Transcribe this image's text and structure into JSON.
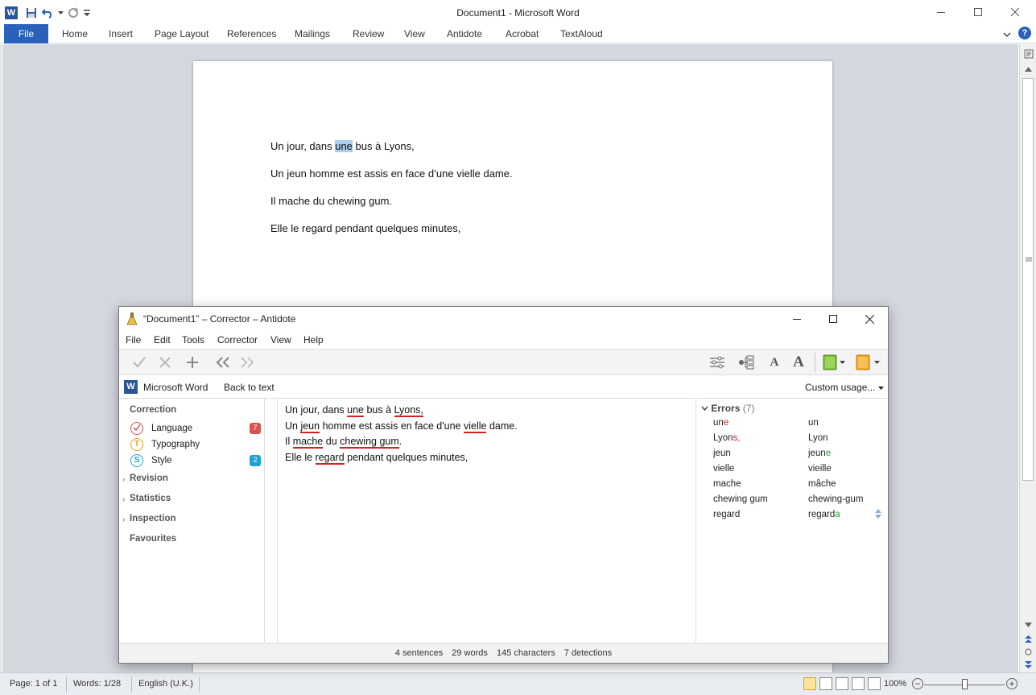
{
  "word": {
    "title": "Document1  -  Microsoft Word",
    "app_icon_letter": "W",
    "file_tab": "File",
    "tabs": [
      "Home",
      "Insert",
      "Page Layout",
      "References",
      "Mailings",
      "Review",
      "View",
      "Antidote",
      "Acrobat",
      "TextAloud"
    ],
    "help_label": "?",
    "document_lines": [
      {
        "before": "Un jour, dans ",
        "selected": "une",
        "after": " bus à Lyons,"
      },
      {
        "before": "Un jeun homme est assis en face d’une vielle dame.",
        "selected": "",
        "after": ""
      },
      {
        "before": "Il mache du chewing gum.",
        "selected": "",
        "after": ""
      },
      {
        "before": "Elle le regard pendant quelques minutes,",
        "selected": "",
        "after": ""
      }
    ],
    "status": {
      "page": "Page: 1 of 1",
      "words": "Words: 1/28",
      "language": "English (U.K.)",
      "zoom": "100%",
      "zoom_level_percent": 100
    }
  },
  "antidote": {
    "title": "“Document1” – Corrector – Antidote",
    "menu": [
      "File",
      "Edit",
      "Tools",
      "Corrector",
      "View",
      "Help"
    ],
    "source_app": "Microsoft Word",
    "back_to_text": "Back to text",
    "custom_usage": "Custom usage...",
    "nav": {
      "correction_label": "Correction",
      "items": [
        {
          "label": "Language",
          "icon_letter": "",
          "badge": "7",
          "color": "#d9534f"
        },
        {
          "label": "Typography",
          "icon_letter": "T",
          "badge": "",
          "color": "#e8a317"
        },
        {
          "label": "Style",
          "icon_letter": "S",
          "badge": "2",
          "color": "#1ea1d6"
        }
      ],
      "revision_label": "Revision",
      "statistics_label": "Statistics",
      "inspection_label": "Inspection",
      "favourites_label": "Favourites"
    },
    "text_lines": [
      [
        {
          "t": "Un jour, dans ",
          "e": false
        },
        {
          "t": "une",
          "e": true
        },
        {
          "t": " bus à ",
          "e": false
        },
        {
          "t": "Lyons,",
          "e": true
        }
      ],
      [
        {
          "t": "Un ",
          "e": false
        },
        {
          "t": "jeun",
          "e": true
        },
        {
          "t": " homme est assis en face d'une ",
          "e": false
        },
        {
          "t": "vielle",
          "e": true
        },
        {
          "t": " dame.",
          "e": false
        }
      ],
      [
        {
          "t": "Il ",
          "e": false
        },
        {
          "t": "mache",
          "e": true
        },
        {
          "t": " du ",
          "e": false
        },
        {
          "t": "chewing gum",
          "e": true
        },
        {
          "t": ".",
          "e": false
        }
      ],
      [
        {
          "t": "Elle le ",
          "e": false
        },
        {
          "t": "regard",
          "e": true
        },
        {
          "t": " pendant quelques minutes,",
          "e": false
        }
      ]
    ],
    "errors": {
      "label": "Errors",
      "count": "(7)",
      "rows": [
        {
          "word": [
            {
              "t": "un",
              "c": ""
            },
            {
              "t": "e",
              "c": "red"
            }
          ],
          "sugg": [
            {
              "t": "un",
              "c": ""
            }
          ]
        },
        {
          "word": [
            {
              "t": "Lyon",
              "c": ""
            },
            {
              "t": "s,",
              "c": "red"
            }
          ],
          "sugg": [
            {
              "t": "Lyon",
              "c": ""
            }
          ]
        },
        {
          "word": [
            {
              "t": "jeun",
              "c": ""
            }
          ],
          "sugg": [
            {
              "t": "jeun",
              "c": ""
            },
            {
              "t": "e",
              "c": "green"
            }
          ]
        },
        {
          "word": [
            {
              "t": "vielle",
              "c": ""
            }
          ],
          "sugg": [
            {
              "t": "vieille",
              "c": ""
            }
          ]
        },
        {
          "word": [
            {
              "t": "mache",
              "c": ""
            }
          ],
          "sugg": [
            {
              "t": "mâche",
              "c": ""
            }
          ]
        },
        {
          "word": [
            {
              "t": "chewing gum",
              "c": ""
            }
          ],
          "sugg": [
            {
              "t": "chewing-gum",
              "c": ""
            }
          ]
        },
        {
          "word": [
            {
              "t": "regard",
              "c": ""
            }
          ],
          "sugg": [
            {
              "t": "regard",
              "c": ""
            },
            {
              "t": "a",
              "c": "green"
            }
          ]
        }
      ]
    },
    "status": {
      "sentences": "4 sentences",
      "words": "29 words",
      "characters": "145 characters",
      "detections": "7 detections"
    }
  }
}
